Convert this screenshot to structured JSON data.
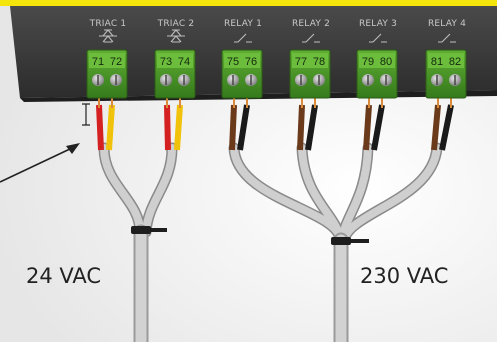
{
  "device": {
    "outputs": [
      {
        "label": "TRIAC 1",
        "terminals": [
          "71",
          "72"
        ],
        "type": "triac"
      },
      {
        "label": "TRIAC 2",
        "terminals": [
          "73",
          "74"
        ],
        "type": "triac"
      },
      {
        "label": "RELAY 1",
        "terminals": [
          "75",
          "76"
        ],
        "type": "relay"
      },
      {
        "label": "RELAY 2",
        "terminals": [
          "77",
          "78"
        ],
        "type": "relay"
      },
      {
        "label": "RELAY 3",
        "terminals": [
          "79",
          "80"
        ],
        "type": "relay"
      },
      {
        "label": "RELAY 4",
        "terminals": [
          "81",
          "82"
        ],
        "type": "relay"
      }
    ]
  },
  "voltages": {
    "left": "24 VAC",
    "right": "230 VAC"
  },
  "colors": {
    "housing": "#3a3a3a",
    "trim": "#f4e60a",
    "terminal_block": "#4d9a2a",
    "wire_red": "#d42020",
    "wire_yellow": "#f0c20a",
    "wire_brown": "#6b3a1a",
    "wire_black": "#1a1a1a",
    "cable": "#c4c4c4"
  },
  "icons": [
    "triac-symbol-icon",
    "relay-symbol-icon",
    "strip-length-icon",
    "pointer-arrow-icon"
  ]
}
